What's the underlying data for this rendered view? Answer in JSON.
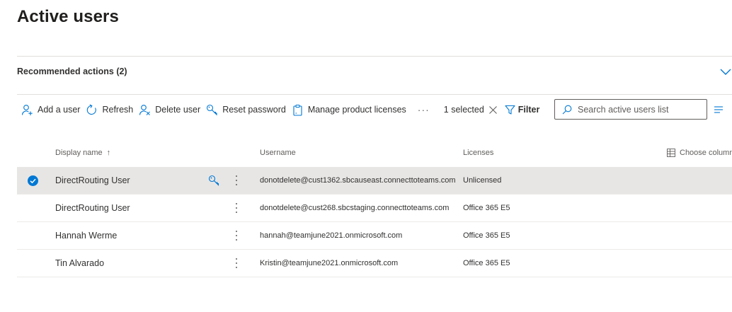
{
  "page": {
    "title": "Active users"
  },
  "recommended": {
    "label": "Recommended actions (2)"
  },
  "toolbar": {
    "add_user": "Add a user",
    "refresh": "Refresh",
    "delete_user": "Delete user",
    "reset_password": "Reset password",
    "manage_licenses": "Manage product licenses",
    "more": "···",
    "selected": "1 selected",
    "filter": "Filter",
    "search_placeholder": "Search active users list"
  },
  "table": {
    "headers": {
      "display_name": "Display name",
      "sort_arrow": "↑",
      "username": "Username",
      "licenses": "Licenses",
      "choose_columns": "Choose columns"
    },
    "rows": [
      {
        "name": "DirectRouting User",
        "username": "donotdelete@cust1362.sbcauseast.connecttoteams.com",
        "license": "Unlicensed",
        "selected": true
      },
      {
        "name": "DirectRouting User",
        "username": "donotdelete@cust268.sbcstaging.connecttoteams.com",
        "license": "Office 365 E5",
        "selected": false
      },
      {
        "name": "Hannah Werme",
        "username": "hannah@teamjune2021.onmicrosoft.com",
        "license": "Office 365 E5",
        "selected": false
      },
      {
        "name": "Tin Alvarado",
        "username": "Kristin@teamjune2021.onmicrosoft.com",
        "license": "Office 365 E5",
        "selected": false
      }
    ]
  },
  "colors": {
    "accent": "#0078d4",
    "selected_row": "#e7e6e5",
    "text": "#323130"
  }
}
